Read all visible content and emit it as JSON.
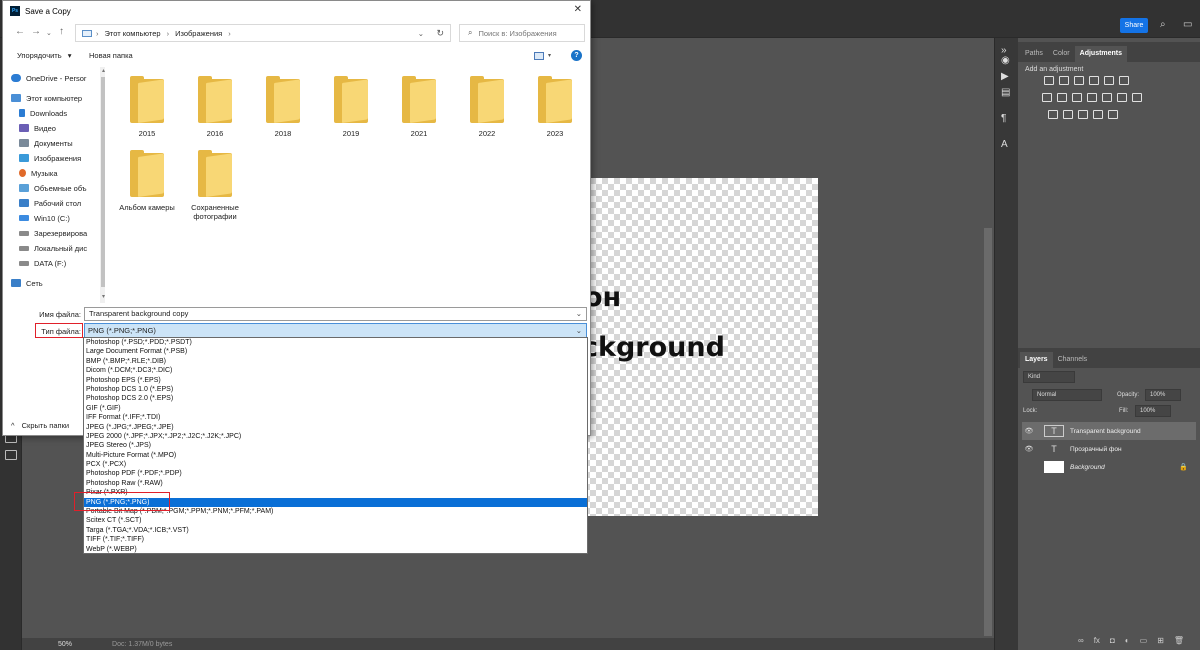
{
  "photoshop": {
    "share_label": "Share",
    "zoom": "50%",
    "doc_info": "Doc: 1.37M/0 bytes",
    "canvas_text_line1": "он",
    "canvas_text_line2": "ckground",
    "panel_tabs": [
      "Paths",
      "Color",
      "Adjustments"
    ],
    "add_adjustment_label": "Add an adjustment",
    "layers_tabs": [
      "Layers",
      "Channels"
    ],
    "kind_filter": "Kind",
    "blend_mode": "Normal",
    "opacity_label": "Opacity:",
    "opacity_value": "100%",
    "lock_label": "Lock:",
    "fill_label": "Fill:",
    "fill_value": "100%",
    "layers": [
      {
        "name": "Transparent background",
        "type": "text",
        "visible": true,
        "selected": true
      },
      {
        "name": "Прозрачный фон",
        "type": "text",
        "visible": true,
        "selected": false
      },
      {
        "name": "Background",
        "type": "pixel",
        "visible": false,
        "selected": false,
        "locked": true
      }
    ]
  },
  "dialog": {
    "title": "Save a Copy",
    "breadcrumb": [
      "Этот компьютер",
      "Изображения"
    ],
    "search_placeholder": "Поиск в: Изображения",
    "organize_label": "Упорядочить",
    "new_folder_label": "Новая папка",
    "nav_items": [
      {
        "label": "OneDrive - Persor",
        "icon": "cloud-icon",
        "color": "#2b7cd3"
      },
      {
        "label": "Этот компьютер",
        "icon": "computer-icon",
        "color": "#4a8fd6"
      },
      {
        "label": "Downloads",
        "icon": "download-icon",
        "color": "#2b7cd3"
      },
      {
        "label": "Видео",
        "icon": "video-icon",
        "color": "#6b5fb5"
      },
      {
        "label": "Документы",
        "icon": "documents-icon",
        "color": "#7a8a9a"
      },
      {
        "label": "Изображения",
        "icon": "pictures-icon",
        "color": "#3a9ad9"
      },
      {
        "label": "Музыка",
        "icon": "music-icon",
        "color": "#e06a2a"
      },
      {
        "label": "Объемные объ",
        "icon": "3d-objects-icon",
        "color": "#5aa0d8"
      },
      {
        "label": "Рабочий стол",
        "icon": "desktop-icon",
        "color": "#3a7fc8"
      },
      {
        "label": "Win10 (C:)",
        "icon": "drive-windows-icon",
        "color": "#3c8be0"
      },
      {
        "label": "Зарезервирова",
        "icon": "drive-icon",
        "color": "#8a8a8a"
      },
      {
        "label": "Локальный дис",
        "icon": "drive-icon",
        "color": "#8a8a8a"
      },
      {
        "label": "DATA (F:)",
        "icon": "drive-icon",
        "color": "#8a8a8a"
      },
      {
        "label": "Сеть",
        "icon": "network-icon",
        "color": "#3a7fc8"
      }
    ],
    "folders": [
      {
        "name": "2015",
        "has_content": false
      },
      {
        "name": "2016",
        "has_content": true
      },
      {
        "name": "2018",
        "has_content": false
      },
      {
        "name": "2019",
        "has_content": true
      },
      {
        "name": "2021",
        "has_content": true
      },
      {
        "name": "2022",
        "has_content": true
      },
      {
        "name": "2023",
        "has_content": true
      },
      {
        "name": "Альбом камеры",
        "has_content": false
      },
      {
        "name": "Сохраненные фотографии",
        "has_content": false
      }
    ],
    "filename_label": "Имя файла:",
    "filename_value": "Transparent background copy",
    "filetype_label": "Тип файла:",
    "filetype_value": "PNG (*.PNG;*.PNG)",
    "hide_folders_label": "Скрыть папки",
    "filetype_options": [
      "Photoshop (*.PSD;*.PDD;*.PSDT)",
      "Large Document Format (*.PSB)",
      "BMP (*.BMP;*.RLE;*.DIB)",
      "Dicom (*.DCM;*.DC3;*.DIC)",
      "Photoshop EPS (*.EPS)",
      "Photoshop DCS 1.0 (*.EPS)",
      "Photoshop DCS 2.0 (*.EPS)",
      "GIF (*.GIF)",
      "IFF Format (*.IFF;*.TDI)",
      "JPEG (*.JPG;*.JPEG;*.JPE)",
      "JPEG 2000 (*.JPF;*.JPX;*.JP2;*.J2C;*.J2K;*.JPC)",
      "JPEG Stereo (*.JPS)",
      "Multi-Picture Format (*.MPO)",
      "PCX (*.PCX)",
      "Photoshop PDF (*.PDF;*.PDP)",
      "Photoshop Raw (*.RAW)",
      "Pixar (*.PXR)",
      "PNG (*.PNG;*.PNG)",
      "Portable Bit Map (*.PBM;*.PGM;*.PPM;*.PNM;*.PFM;*.PAM)",
      "Scitex CT (*.SCT)",
      "Targa (*.TGA;*.VDA;*.ICB;*.VST)",
      "TIFF (*.TIF;*.TIFF)",
      "WebP (*.WEBP)"
    ],
    "selected_option_index": 17,
    "colors": {
      "selection": "#0a6fd6",
      "highlight": "#e0202a",
      "folder": "#f8d775"
    }
  }
}
